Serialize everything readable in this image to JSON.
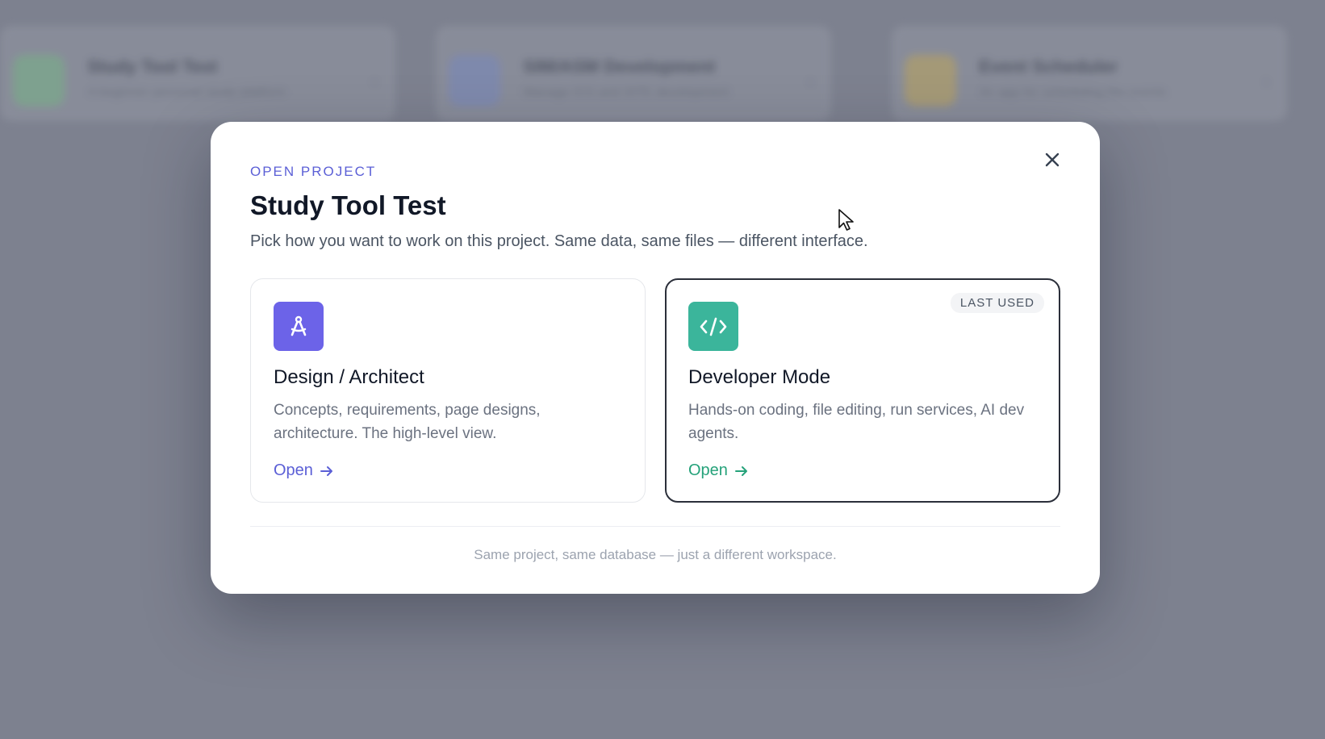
{
  "background_cards": [
    {
      "title": "Study Tool Test",
      "subtitle": "A beginner personal study platform",
      "icon_color": "#7fa58f",
      "icon_letter": "S"
    },
    {
      "title": "SIM/ASM Development",
      "subtitle": "Manage ICS and SITE development",
      "icon_color": "#7f8ab0",
      "icon_letter": "S"
    },
    {
      "title": "Event Scheduler",
      "subtitle": "An app for scheduling the events",
      "icon_color": "#a99c75",
      "icon_letter": "E"
    }
  ],
  "modal": {
    "eyebrow": "OPEN PROJECT",
    "title": "Study Tool Test",
    "subtitle": "Pick how you want to work on this project. Same data, same files — different interface.",
    "close_icon": "close-icon",
    "cards": [
      {
        "title": "Design / Architect",
        "description": "Concepts, requirements, page designs, architecture. The high-level view.",
        "link_label": "Open",
        "icon": "compass-icon",
        "icon_color": "#6c63e8",
        "accent": "#5b5fd6"
      },
      {
        "title": "Developer Mode",
        "description": "Hands-on coding, file editing, run services, AI dev agents.",
        "link_label": "Open",
        "icon": "code-icon",
        "icon_color": "#3bb59b",
        "accent": "#25a27a",
        "badge": "LAST USED"
      }
    ],
    "footer_note": "Same project, same database — just a different workspace."
  }
}
